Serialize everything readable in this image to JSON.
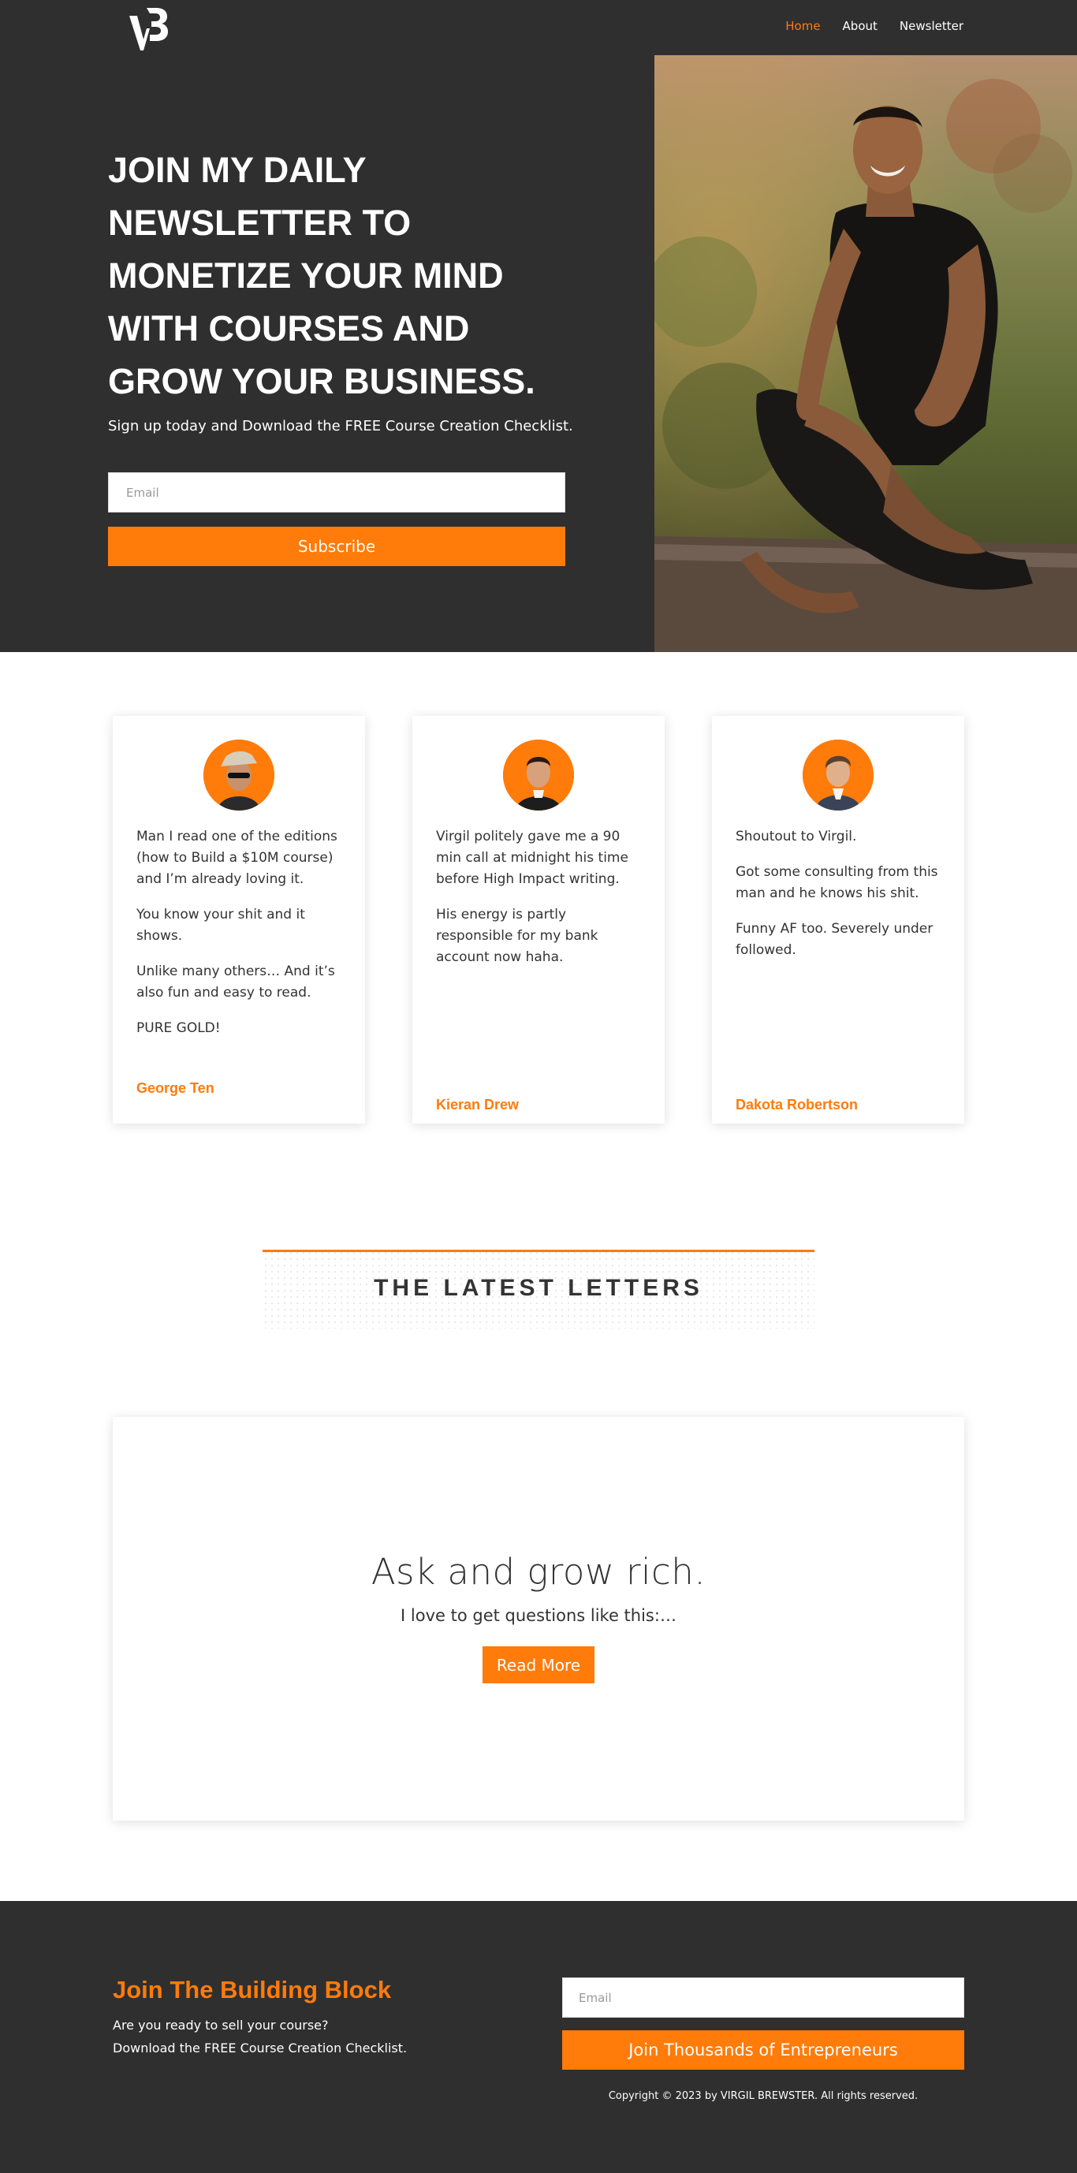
{
  "brand": {
    "logo_text": "VB",
    "accent_color": "#ff7b0a",
    "dark_color": "#2f2f2f"
  },
  "nav": {
    "items": [
      "Home",
      "About",
      "Newsletter"
    ],
    "active": "Home"
  },
  "hero": {
    "title": "JOIN MY DAILY NEWSLETTER TO MONETIZE YOUR MIND WITH COURSES AND GROW YOUR BUSINESS.",
    "subtitle": "Sign up today and Download the FREE Course Creation Checklist.",
    "email_placeholder": "Email",
    "subscribe_label": "Subscribe"
  },
  "testimonials": [
    {
      "paragraphs": [
        "Man I read one of the editions (how to Build a $10M course) and I’m already loving it.",
        "You know your shit and it shows.",
        "Unlike many others… And it’s also fun and easy to read.",
        "PURE GOLD!"
      ],
      "author": "George Ten"
    },
    {
      "paragraphs": [
        "Virgil politely gave me a 90 min call at midnight his time before High Impact writing.",
        "His energy is partly responsible for my bank account now haha."
      ],
      "author": "Kieran Drew"
    },
    {
      "paragraphs": [
        "Shoutout to Virgil.",
        "Got some consulting from this man and he knows his shit.",
        "Funny AF too. Severely under followed."
      ],
      "author": "Dakota Robertson"
    }
  ],
  "latest": {
    "heading": "THE LATEST LETTERS"
  },
  "article": {
    "title": "Ask and grow rich.",
    "excerpt": "I love to get questions like this:…",
    "read_more_label": "Read More"
  },
  "footer": {
    "heading": "Join The Building Block",
    "line1": "Are you ready to sell your course?",
    "line2": "Download the FREE Course Creation Checklist.",
    "email_placeholder": "Email",
    "button_label": "Join Thousands of Entrepreneurs",
    "copyright": "Copyright © 2023 by VIRGIL BREWSTER. All rights reserved."
  }
}
